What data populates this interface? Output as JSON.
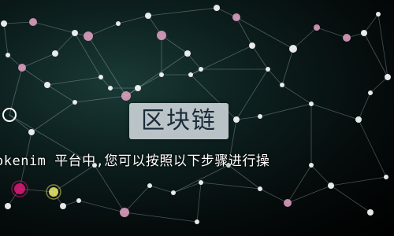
{
  "badge": {
    "text": "区块链"
  },
  "caption": {
    "text": "okenim 平台中,您可以按照以下步骤进行操"
  },
  "colors": {
    "node_pink": "#e6a5c8",
    "node_white": "#ffffff",
    "node_yellow": "#f2f06a",
    "node_magenta": "#e01a78",
    "line": "#c9d8de"
  }
}
